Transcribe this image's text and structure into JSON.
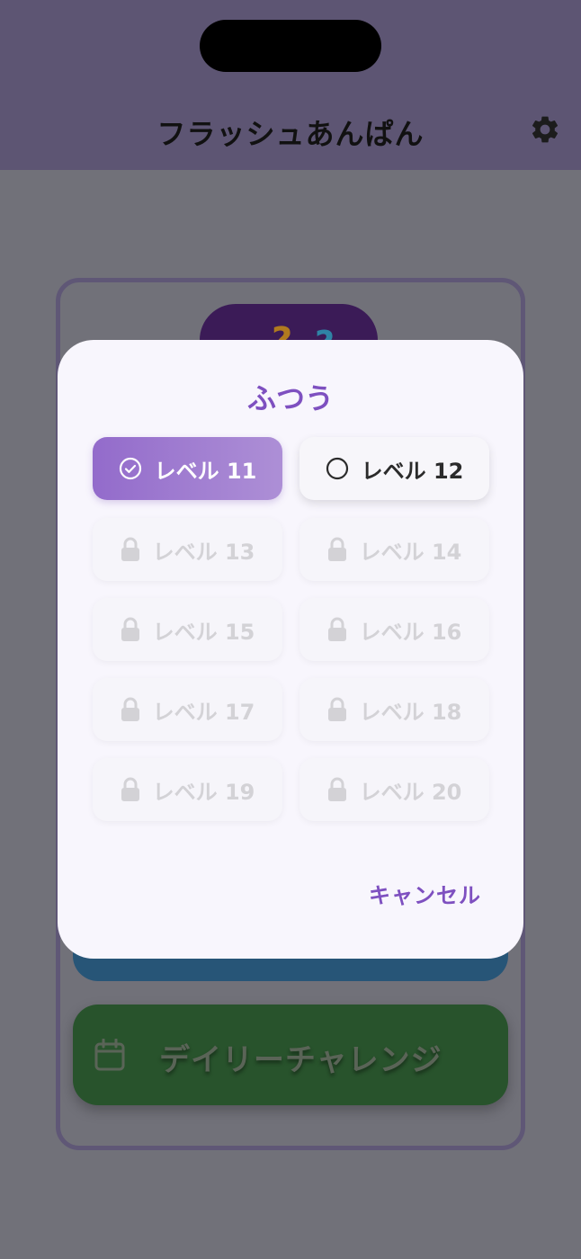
{
  "header": {
    "title": "フラッシュあんぱん",
    "settings_icon": "gear-icon"
  },
  "background": {
    "logo_glyphs": [
      "?",
      "?"
    ],
    "daily_challenge_label": "デイリーチャレンジ",
    "daily_challenge_icon": "calendar-icon"
  },
  "modal": {
    "title": "ふつう",
    "levels": [
      {
        "label": "レベル 11",
        "state": "selected",
        "icon": "check-circle-icon"
      },
      {
        "label": "レベル 12",
        "state": "unlocked",
        "icon": "circle-icon"
      },
      {
        "label": "レベル 13",
        "state": "locked",
        "icon": "lock-icon"
      },
      {
        "label": "レベル 14",
        "state": "locked",
        "icon": "lock-icon"
      },
      {
        "label": "レベル 15",
        "state": "locked",
        "icon": "lock-icon"
      },
      {
        "label": "レベル 16",
        "state": "locked",
        "icon": "lock-icon"
      },
      {
        "label": "レベル 17",
        "state": "locked",
        "icon": "lock-icon"
      },
      {
        "label": "レベル 18",
        "state": "locked",
        "icon": "lock-icon"
      },
      {
        "label": "レベル 19",
        "state": "locked",
        "icon": "lock-icon"
      },
      {
        "label": "レベル 20",
        "state": "locked",
        "icon": "lock-icon"
      }
    ],
    "cancel_label": "キャンセル"
  },
  "colors": {
    "accent": "#7e50c0",
    "header_bg": "#5d5573",
    "overlay_bg": "#717179",
    "modal_bg": "#f8f6fd"
  }
}
